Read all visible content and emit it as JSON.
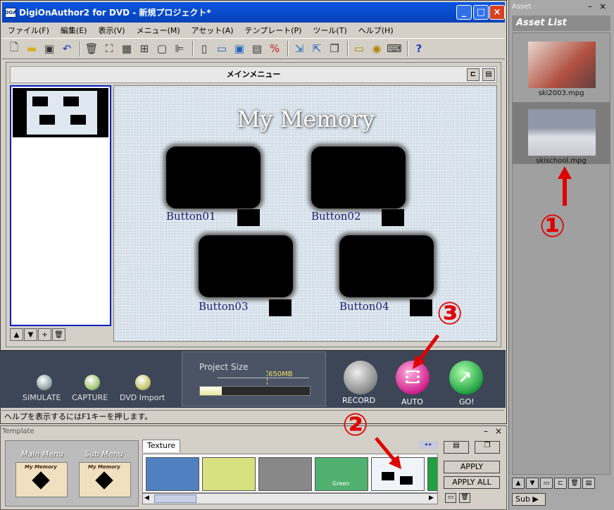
{
  "window": {
    "title": "DigiOnAuthor2 for DVD - 新規プロジェクト*",
    "app_icon": "DOA"
  },
  "menu": [
    "ファイル(F)",
    "編集(E)",
    "表示(V)",
    "メニュー(M)",
    "アセット(A)",
    "テンプレート(P)",
    "ツール(T)",
    "ヘルプ(H)"
  ],
  "editor": {
    "header": "メインメニュー"
  },
  "canvas": {
    "title": "My Memory",
    "buttons": [
      "Button01",
      "Button02",
      "Button03",
      "Button04"
    ]
  },
  "controls": {
    "simulate": "SIMULATE",
    "capture": "CAPTURE",
    "dvd_import": "DVD Import",
    "project_size_label": "Project Size",
    "project_size_value": "650MB",
    "project_size_fill": 0.2,
    "record": "RECORD",
    "auto": "AUTO",
    "go": "GO!"
  },
  "status": "ヘルプを表示するにはF1キーを押します。",
  "asset": {
    "panel_label": "Asset",
    "title": "Asset List",
    "items": [
      "ski2003.mpg",
      "skischool.mpg"
    ],
    "sub_button": "Sub ▶"
  },
  "template": {
    "panel_label": "Template",
    "main_menu": "Main Menu",
    "sub_menu": "Sub Menu",
    "tab": "Texture",
    "thumb_title": "My Memory",
    "green_label": "Green",
    "apply": "APPLY",
    "apply_all": "APPLY ALL"
  },
  "annotations": [
    "①",
    "②",
    "③"
  ],
  "colors": {
    "title_bar": "#0a54e0",
    "annotation": "#e00000",
    "control_panel": "#3c4656"
  }
}
